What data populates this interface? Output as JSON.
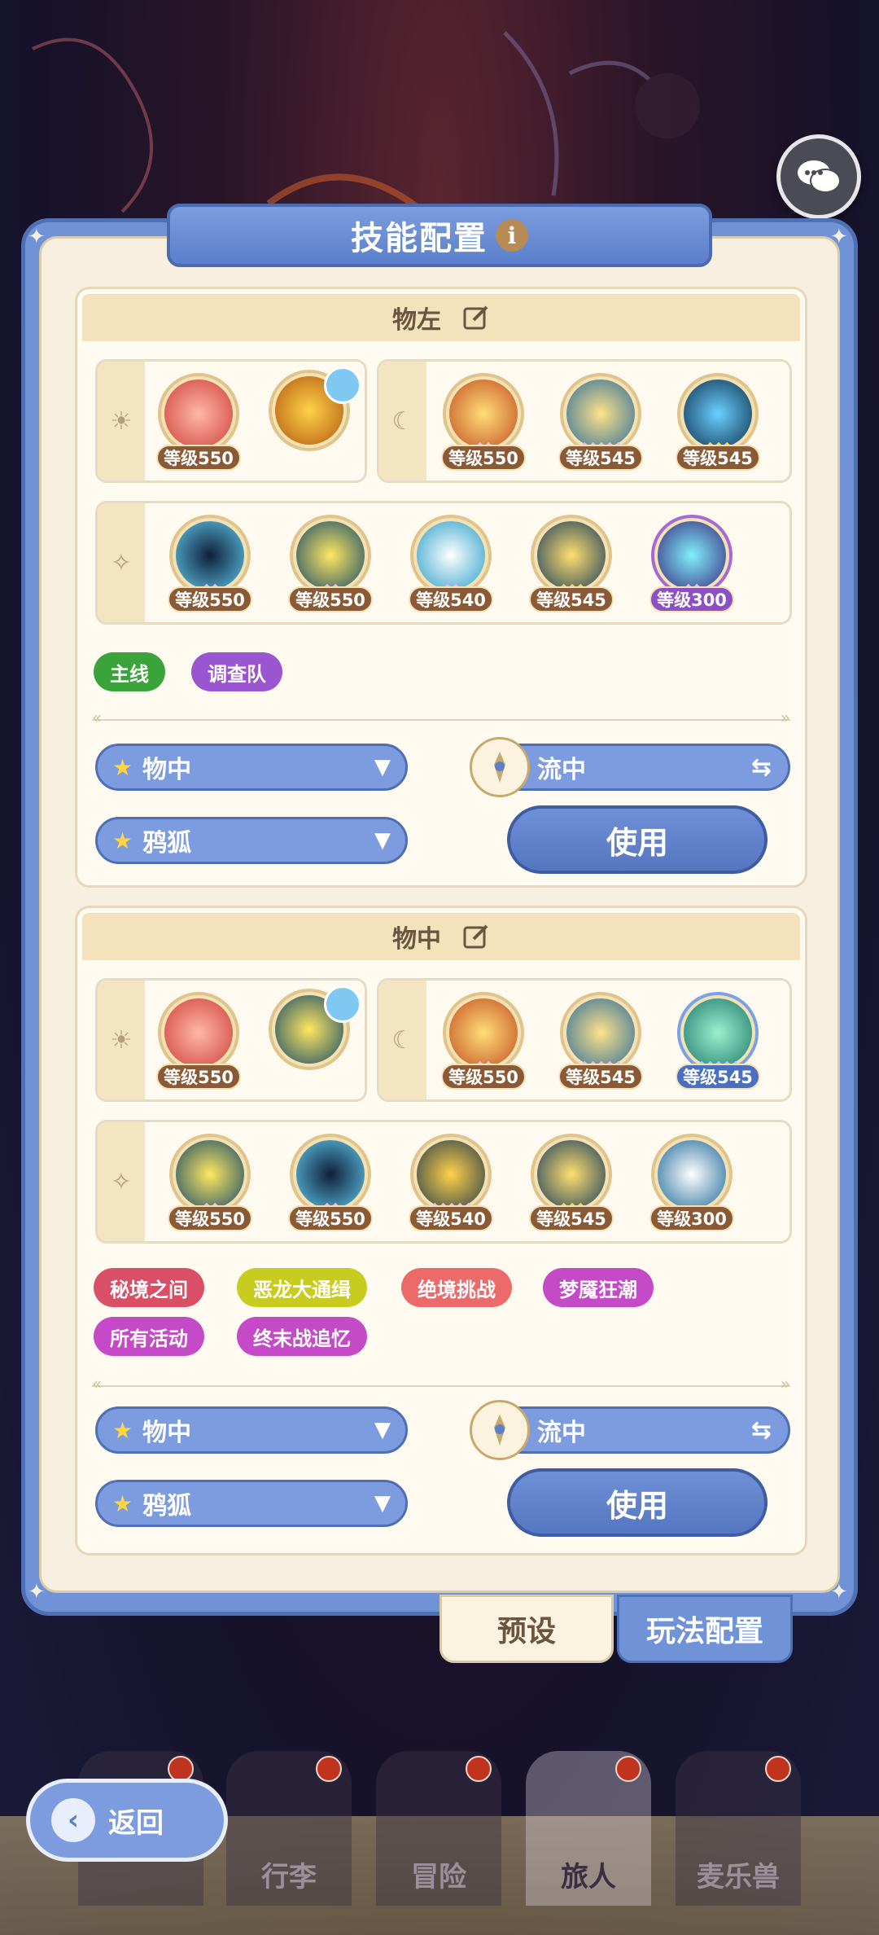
{
  "header": {
    "title": "技能配置"
  },
  "sections": [
    {
      "name": "物左",
      "sun_levels": [
        "等级550"
      ],
      "moon_levels": [
        "等级550",
        "等级545",
        "等级545"
      ],
      "star_levels": [
        "等级550",
        "等级550",
        "等级540",
        "等级545",
        "等级300"
      ],
      "tags": [
        {
          "label": "主线",
          "color": "#3aa33a"
        },
        {
          "label": "调查队",
          "color": "#9a55d0"
        }
      ],
      "dropdown1": "物中",
      "dropdown2": "鸦狐",
      "mode": "流中",
      "use_label": "使用"
    },
    {
      "name": "物中",
      "sun_levels": [
        "等级550"
      ],
      "moon_levels": [
        "等级550",
        "等级545",
        "等级545"
      ],
      "star_levels": [
        "等级550",
        "等级550",
        "等级540",
        "等级545",
        "等级300"
      ],
      "tags": [
        {
          "label": "秘境之间",
          "color": "#d94f66"
        },
        {
          "label": "恶龙大通缉",
          "color": "#c7cc1e"
        },
        {
          "label": "绝境挑战",
          "color": "#ec6a6a"
        },
        {
          "label": "梦魇狂潮",
          "color": "#c54ac8"
        },
        {
          "label": "所有活动",
          "color": "#c54ac8"
        },
        {
          "label": "终末战追忆",
          "color": "#c54ac8"
        }
      ],
      "dropdown1": "物中",
      "dropdown2": "鸦狐",
      "mode": "流中",
      "use_label": "使用"
    }
  ],
  "bottom_tabs": {
    "preset": "预设",
    "mode_config": "玩法配置"
  },
  "nav": [
    {
      "label": "行李"
    },
    {
      "label": "冒险"
    },
    {
      "label": "旅人"
    },
    {
      "label": "麦乐兽"
    }
  ],
  "back_label": "返回",
  "icons": [
    "sun-icon",
    "moon-icon",
    "sparkle-icon",
    "edit-icon",
    "info-icon",
    "chat-icon",
    "swap-icon",
    "star-icon"
  ]
}
